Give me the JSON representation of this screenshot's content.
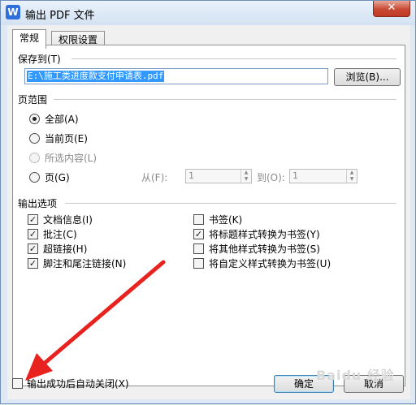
{
  "window": {
    "app_icon": "W",
    "title": "输出 PDF 文件",
    "close_glyph": "✕"
  },
  "tabs": [
    {
      "label": "常规"
    },
    {
      "label": "权限设置"
    }
  ],
  "save_to": {
    "label": "保存到(T)",
    "path_value": "E:\\施工类进度款支付申请表.pdf",
    "browse_label": "浏览(B)..."
  },
  "page_range": {
    "label": "页范围",
    "options": [
      {
        "label": "全部(A)",
        "checked": true,
        "disabled": false
      },
      {
        "label": "当前页(E)",
        "checked": false,
        "disabled": false
      },
      {
        "label": "所选内容(L)",
        "checked": false,
        "disabled": true
      },
      {
        "label": "页(G)",
        "checked": false,
        "disabled": false
      }
    ],
    "from_label": "从(F):",
    "from_value": "1",
    "to_label": "到(O):",
    "to_value": "1"
  },
  "output_options": {
    "label": "输出选项",
    "left": [
      {
        "label": "文档信息(I)",
        "checked": true
      },
      {
        "label": "批注(C)",
        "checked": true
      },
      {
        "label": "超链接(H)",
        "checked": true
      },
      {
        "label": "脚注和尾注链接(N)",
        "checked": true
      }
    ],
    "right": [
      {
        "label": "书签(K)",
        "checked": false
      },
      {
        "label": "将标题样式转换为书签(Y)",
        "checked": true
      },
      {
        "label": "将其他样式转换为书签(S)",
        "checked": false
      },
      {
        "label": "将自定义样式转换为书签(U)",
        "checked": false
      }
    ]
  },
  "footer": {
    "auto_close_label": "输出成功后自动关闭(X)",
    "auto_close_checked": false,
    "ok_label": "确定",
    "cancel_label": "取消"
  },
  "icons": {
    "check": "✓",
    "spin_up": "▲",
    "spin_down": "▼"
  },
  "colors": {
    "selection": "#3399ff",
    "annotation_arrow": "#e8231f"
  },
  "watermark": "Baidu 经验"
}
